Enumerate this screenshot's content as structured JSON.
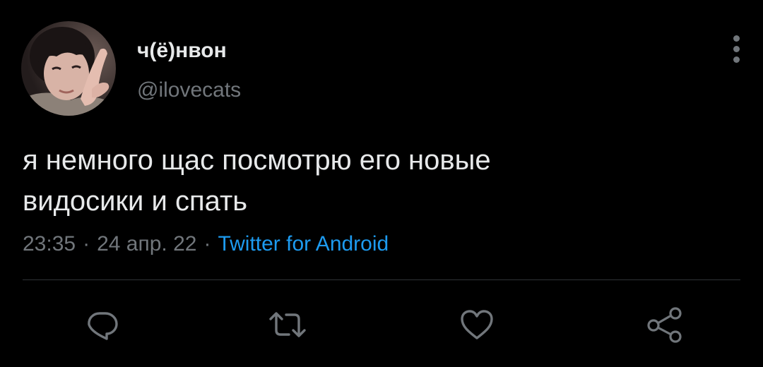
{
  "author": {
    "display_name": "ч(ё)нвон",
    "handle": "@ilovecats"
  },
  "tweet": {
    "text": "я немного щас посмотрю его новые\nвидосики и спать",
    "time": "23:35",
    "date": "24 апр. 22",
    "separator": "·",
    "source": "Twitter for Android"
  },
  "actions": {
    "icons": [
      "reply-icon",
      "retweet-icon",
      "like-icon",
      "share-icon"
    ]
  },
  "colors": {
    "background": "#000000",
    "text_primary": "#e7e9ea",
    "text_secondary": "#71767b",
    "accent": "#1d9bf0",
    "divider": "#2f3336"
  }
}
